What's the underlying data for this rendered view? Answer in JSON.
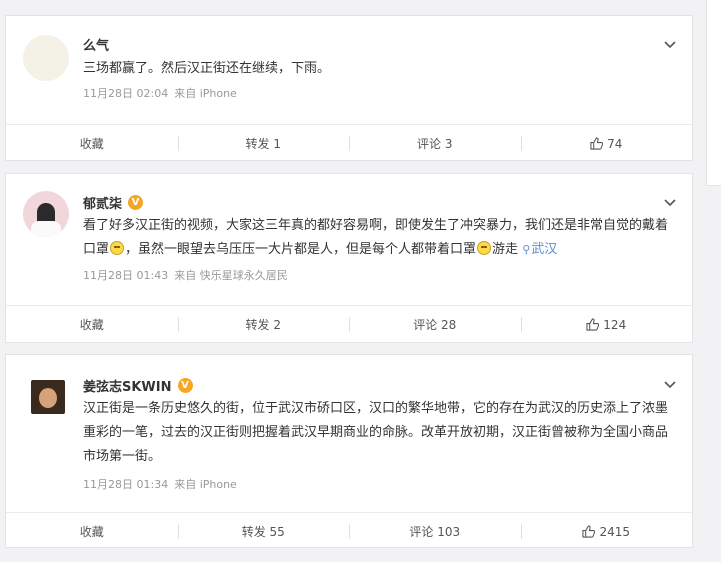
{
  "posts": [
    {
      "author": "么气",
      "verified": false,
      "text": "三场都赢了。然后汉正街还在继续，下雨。",
      "date": "11月28日 02:04",
      "source": "来自 iPhone",
      "actions": {
        "collect": "收藏",
        "repost": "转发 1",
        "comment": "评论 3",
        "like": "74"
      }
    },
    {
      "author": "郁贰柒",
      "verified": true,
      "text_parts": [
        "看了好多汉正街的视频，大家这三年真的都好容易啊，即使发生了冲突暴力，我们还是非常自觉的戴着口罩",
        "，虽然一眼望去乌压压一大片都是人，但是每个人都带着口罩",
        "游走"
      ],
      "location": "武汉",
      "date": "11月28日 01:43",
      "source": "来自 快乐星球永久居民",
      "actions": {
        "collect": "收藏",
        "repost": "转发 2",
        "comment": "评论 28",
        "like": "124"
      }
    },
    {
      "author": "姜弦志SKWIN",
      "verified": true,
      "text": "汉正街是一条历史悠久的街，位于武汉市硚口区，汉口的繁华地带，它的存在为武汉的历史添上了浓墨重彩的一笔，过去的汉正街则把握着武汉早期商业的命脉。改革开放初期，汉正街曾被称为全国小商品市场第一街。",
      "date": "11月28日 01:34",
      "source": "来自 iPhone",
      "actions": {
        "collect": "收藏",
        "repost": "转发 55",
        "comment": "评论 103",
        "like": "2415"
      }
    }
  ],
  "icons": {
    "badge": "verified-badge-icon",
    "chevron": "chevron-down-icon",
    "thumb": "thumbs-up-icon",
    "location": "location-pin-icon",
    "emoji": "grin-emoji-icon"
  },
  "colors": {
    "badge": "#f5a623",
    "link": "#5b8fd0",
    "meta": "#999999"
  }
}
